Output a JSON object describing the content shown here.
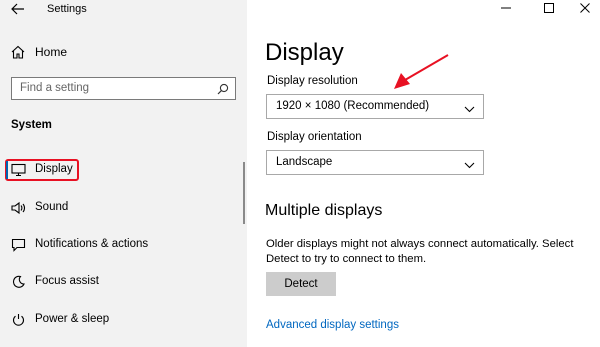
{
  "window": {
    "title": "Settings",
    "controls": [
      "minimize-icon",
      "maximize-icon",
      "close-icon"
    ]
  },
  "sidebar": {
    "home_label": "Home",
    "search_placeholder": "Find a setting",
    "section_title": "System",
    "items": [
      {
        "label": "Display",
        "icon": "monitor-icon",
        "active": true
      },
      {
        "label": "Sound",
        "icon": "speaker-icon"
      },
      {
        "label": "Notifications & actions",
        "icon": "notification-icon"
      },
      {
        "label": "Focus assist",
        "icon": "moon-icon"
      },
      {
        "label": "Power & sleep",
        "icon": "power-icon"
      }
    ]
  },
  "main": {
    "title": "Display",
    "resolution_label": "Display resolution",
    "resolution_value": "1920 × 1080 (Recommended)",
    "orientation_label": "Display orientation",
    "orientation_value": "Landscape",
    "multiple_title": "Multiple displays",
    "multiple_text": "Older displays might not always connect automatically. Select Detect to try to connect to them.",
    "detect_label": "Detect",
    "advanced_link": "Advanced display settings"
  },
  "colors": {
    "accent": "#0063b1",
    "highlight": "#e81123",
    "link": "#0067c0",
    "sidebar_bg": "#f2f2f2"
  }
}
